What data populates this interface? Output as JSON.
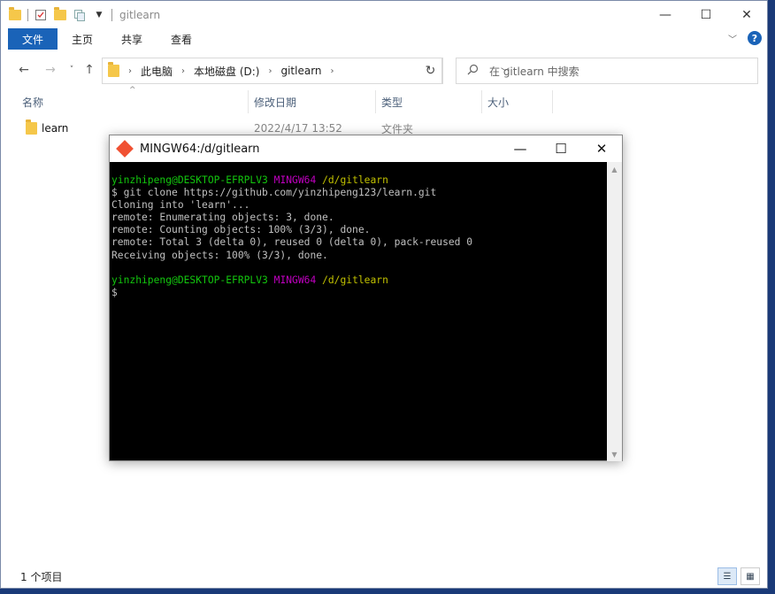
{
  "explorer": {
    "title": "gitlearn",
    "tabs": [
      "文件",
      "主页",
      "共享",
      "查看"
    ],
    "address": [
      "此电脑",
      "本地磁盘 (D:)",
      "gitlearn"
    ],
    "search_placeholder": "在 gitlearn 中搜索",
    "columns": [
      "名称",
      "修改日期",
      "类型",
      "大小"
    ],
    "files": [
      {
        "name": "learn",
        "modified": "2022/4/17 13:52",
        "type": "文件夹",
        "size": ""
      }
    ],
    "status": "1 个项目",
    "help_label": "?"
  },
  "terminal": {
    "title": "MINGW64:/d/gitlearn",
    "prompt_user": "yinzhipeng@DESKTOP-EFRPLV3",
    "prompt_env": "MINGW64",
    "prompt_path": "/d/gitlearn",
    "command_line": "$ git clone https://github.com/yinzhipeng123/learn.git",
    "output": [
      "Cloning into 'learn'...",
      "remote: Enumerating objects: 3, done.",
      "remote: Counting objects: 100% (3/3), done.",
      "remote: Total 3 (delta 0), reused 0 (delta 0), pack-reused 0",
      "Receiving objects: 100% (3/3), done."
    ],
    "cursor_line": "$"
  },
  "colors": {
    "accent": "#1a63b8",
    "desktop": "#1a3a78",
    "term_green": "#13c70e",
    "term_magenta": "#c000c0",
    "term_yellow": "#c0c000"
  }
}
